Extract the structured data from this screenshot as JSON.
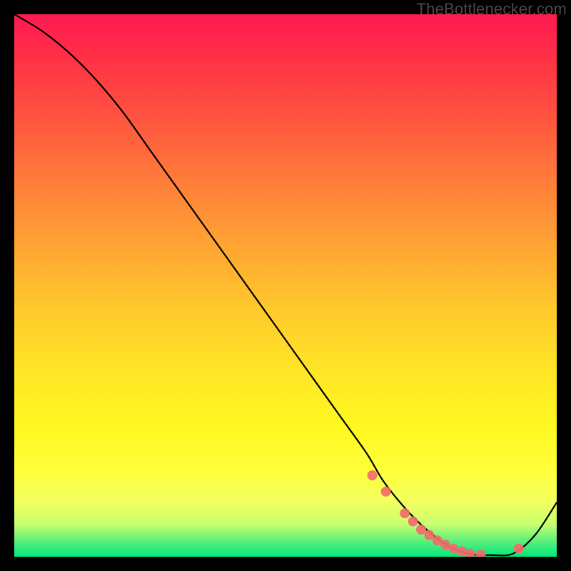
{
  "watermark": "TheBottlenecker.com",
  "chart_data": {
    "type": "line",
    "title": "",
    "xlabel": "",
    "ylabel": "",
    "xlim": [
      0,
      100
    ],
    "ylim": [
      0,
      100
    ],
    "series": [
      {
        "name": "bottleneck-curve",
        "x": [
          0,
          5,
          10,
          15,
          20,
          25,
          30,
          35,
          40,
          45,
          50,
          55,
          60,
          65,
          68,
          72,
          76,
          80,
          84,
          88,
          92,
          96,
          100
        ],
        "values": [
          100,
          97,
          93,
          88,
          82,
          75,
          68,
          61,
          54,
          47,
          40,
          33,
          26,
          19,
          14,
          9,
          5,
          2,
          0.5,
          0.3,
          0.6,
          4,
          10
        ]
      }
    ],
    "markers": {
      "name": "highlight-dots",
      "x": [
        66,
        68.5,
        72,
        73.5,
        75,
        76.5,
        78,
        79.5,
        81,
        82.5,
        84,
        86,
        93
      ],
      "values": [
        15,
        12,
        8,
        6.5,
        5,
        4,
        3,
        2.2,
        1.5,
        1,
        0.6,
        0.4,
        1.5
      ]
    },
    "gradient_stops": [
      {
        "pct": 0,
        "color": "#ff1a50"
      },
      {
        "pct": 18,
        "color": "#ff5040"
      },
      {
        "pct": 42,
        "color": "#ffa233"
      },
      {
        "pct": 66,
        "color": "#ffe626"
      },
      {
        "pct": 90,
        "color": "#f2ff60"
      },
      {
        "pct": 100,
        "color": "#00e87e"
      }
    ]
  }
}
